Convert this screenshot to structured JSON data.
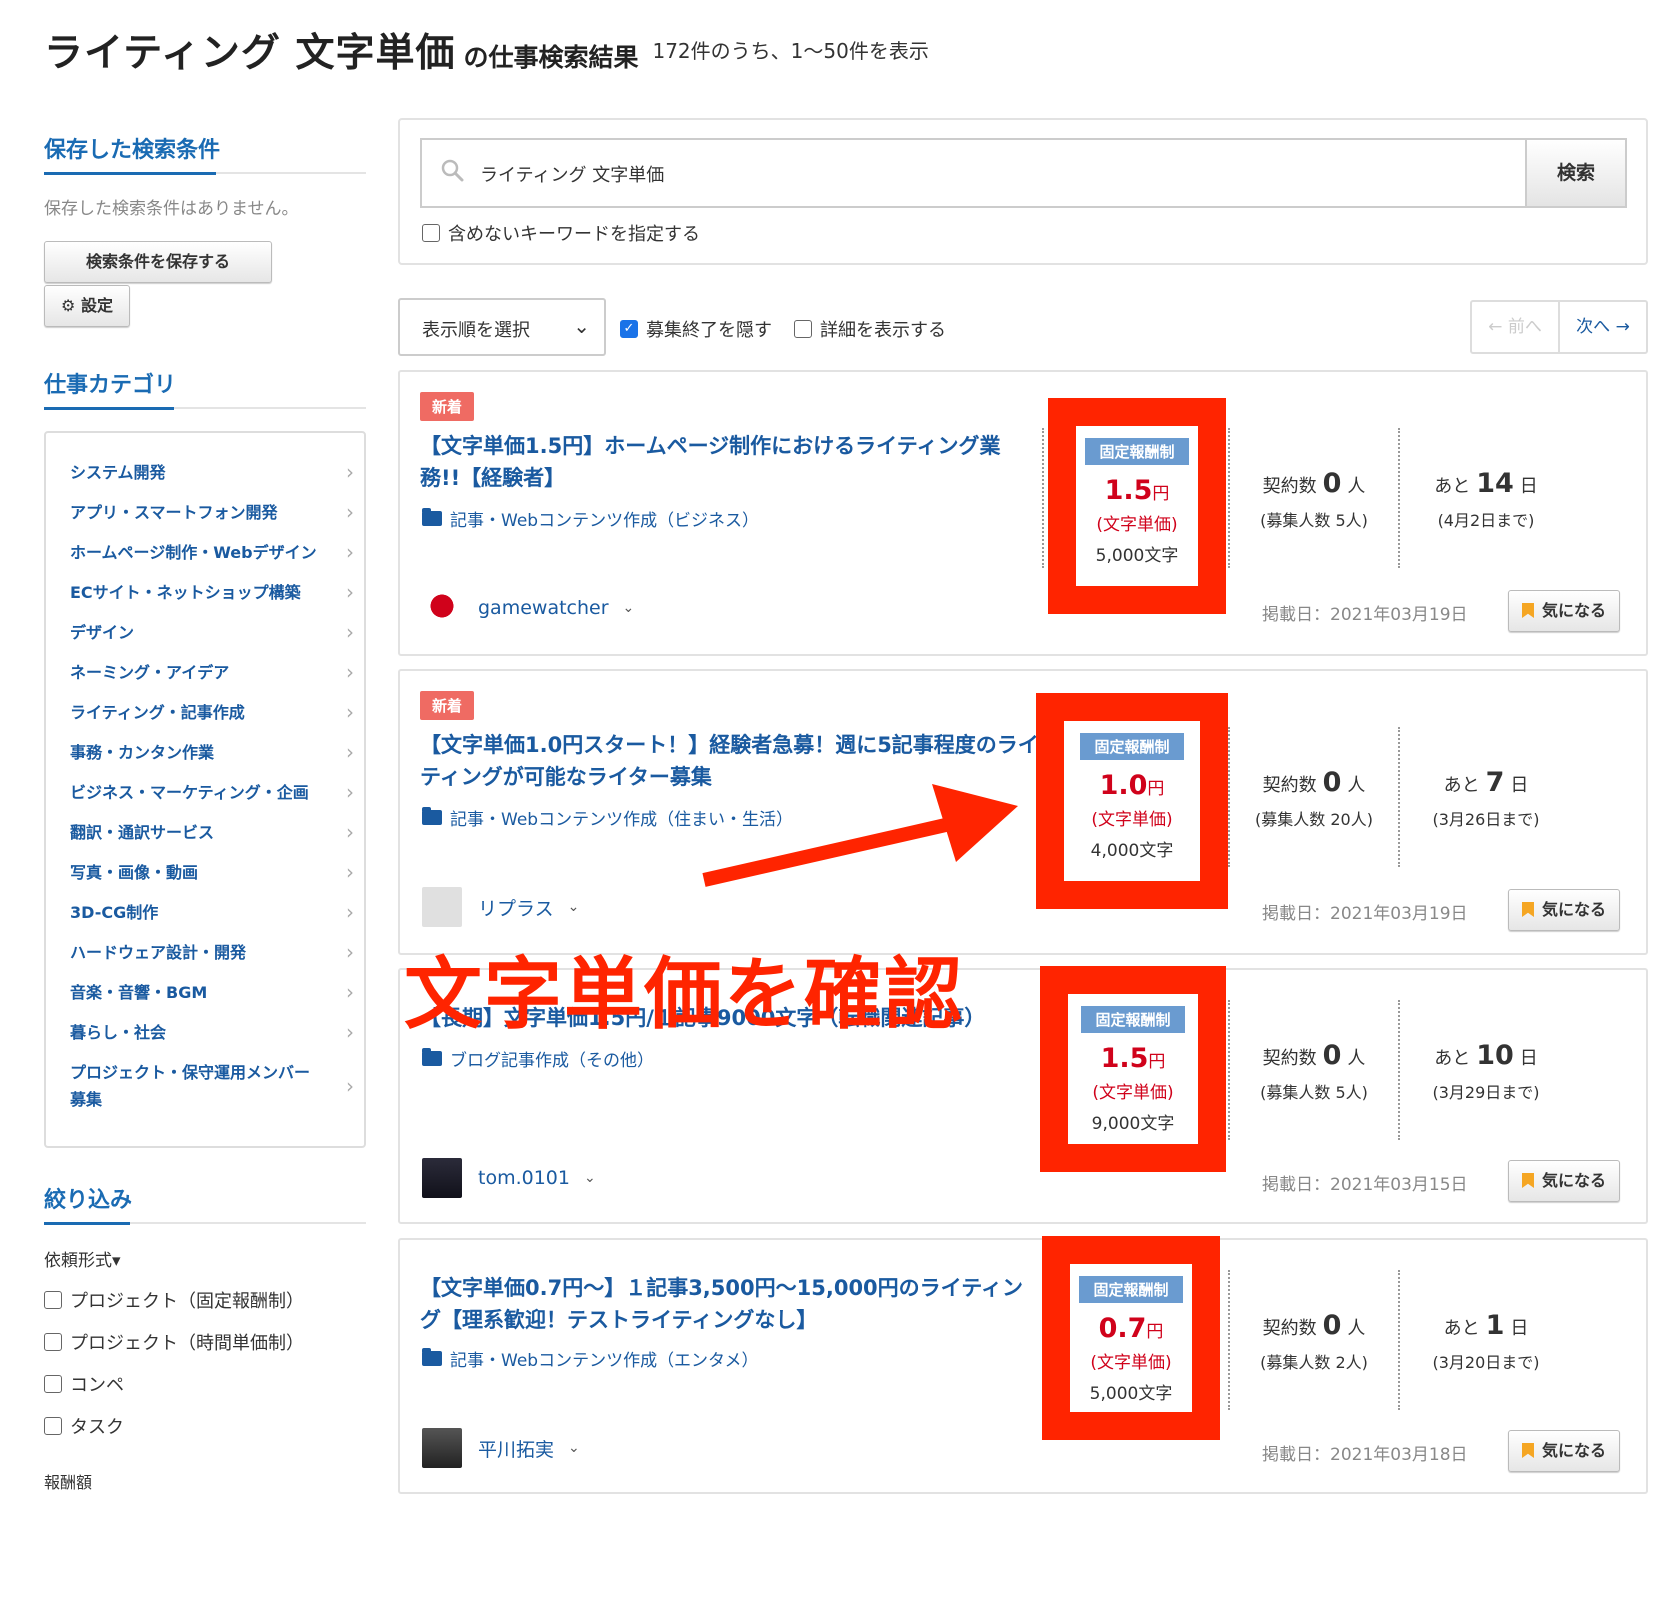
{
  "header": {
    "keyword": "ライティング 文字単価",
    "suffix": "の仕事検索結果",
    "count": "172件のうち、1〜50件を表示"
  },
  "sidebar": {
    "saved_heading": "保存した検索条件",
    "saved_empty": "保存した検索条件はありません。",
    "save_button": "検索条件を保存する",
    "settings_button": "⚙ 設定",
    "category_heading": "仕事カテゴリ",
    "categories": [
      "システム開発",
      "アプリ・スマートフォン開発",
      "ホームページ制作・Webデザイン",
      "ECサイト・ネットショップ構築",
      "デザイン",
      "ネーミング・アイデア",
      "ライティング・記事作成",
      "事務・カンタン作業",
      "ビジネス・マーケティング・企画",
      "翻訳・通訳サービス",
      "写真・画像・動画",
      "3D-CG制作",
      "ハードウェア設計・開発",
      "音楽・音響・BGM",
      "暮らし・社会",
      "プロジェクト・保守運用メンバー募集"
    ],
    "filter_heading": "絞り込み",
    "filter_type_label": "依頼形式▾",
    "filter_options": [
      "プロジェクト（固定報酬制）",
      "プロジェクト（時間単価制）",
      "コンペ",
      "タスク"
    ],
    "more_label": "報酬額"
  },
  "search": {
    "query": "ライティング 文字単価",
    "button": "検索",
    "exclude_label": "含めないキーワードを指定する"
  },
  "controls": {
    "sort_label": "表示順を選択",
    "hide_closed_label": "募集終了を隠す",
    "hide_closed_checked": true,
    "show_detail_label": "詳細を表示する",
    "show_detail_checked": false,
    "prev": "← 前へ",
    "next": "次へ →"
  },
  "jobs": [
    {
      "is_new": true,
      "new_label": "新着",
      "title": "【文字単価1.5円】ホームページ制作におけるライティング業務!!【経験者】",
      "category": "記事・Webコンテンツ作成（ビジネス）",
      "client": "gamewatcher",
      "price_type": "固定報酬制",
      "price": "1.5",
      "price_yen": "円",
      "price_unit": "(文字単価)",
      "chars": "5,000文字",
      "contracts_prefix": "契約数",
      "contracts": "0",
      "contracts_suffix": "人",
      "recruit": "(募集人数 5人)",
      "days_prefix": "あと",
      "days_left": "14",
      "days_suffix": "日",
      "deadline": "(4月2日まで)",
      "posted": "掲載日：2021年03月19日",
      "fav": "気になる"
    },
    {
      "is_new": true,
      "new_label": "新着",
      "title": "【文字単価1.0円スタート！】経験者急募！週に5記事程度のライティングが可能なライター募集",
      "category": "記事・Webコンテンツ作成（住まい・生活）",
      "client": "リプラス",
      "price_type": "固定報酬制",
      "price": "1.0",
      "price_yen": "円",
      "price_unit": "(文字単価)",
      "chars": "4,000文字",
      "contracts_prefix": "契約数",
      "contracts": "0",
      "contracts_suffix": "人",
      "recruit": "(募集人数 20人)",
      "days_prefix": "あと",
      "days_left": "7",
      "days_suffix": "日",
      "deadline": "(3月26日まで)",
      "posted": "掲載日：2021年03月19日",
      "fav": "気になる"
    },
    {
      "is_new": false,
      "title": "【長期】文字単価1.5円/１記事9000文字（転職関連記事）",
      "category": "ブログ記事作成（その他）",
      "client": "tom.0101",
      "price_type": "固定報酬制",
      "price": "1.5",
      "price_yen": "円",
      "price_unit": "(文字単価)",
      "chars": "9,000文字",
      "contracts_prefix": "契約数",
      "contracts": "0",
      "contracts_suffix": "人",
      "recruit": "(募集人数 5人)",
      "days_prefix": "あと",
      "days_left": "10",
      "days_suffix": "日",
      "deadline": "(3月29日まで)",
      "posted": "掲載日：2021年03月15日",
      "fav": "気になる"
    },
    {
      "is_new": false,
      "title": "【文字単価0.7円〜】１記事3,500円〜15,000円のライティング【理系歓迎！テストライティングなし】",
      "category": "記事・Webコンテンツ作成（エンタメ）",
      "client": "平川拓実",
      "price_type": "固定報酬制",
      "price": "0.7",
      "price_yen": "円",
      "price_unit": "(文字単価)",
      "chars": "5,000文字",
      "contracts_prefix": "契約数",
      "contracts": "0",
      "contracts_suffix": "人",
      "recruit": "(募集人数 2人)",
      "days_prefix": "あと",
      "days_left": "1",
      "days_suffix": "日",
      "deadline": "(3月20日まで)",
      "posted": "掲載日：2021年03月18日",
      "fav": "気になる"
    }
  ],
  "annotation": {
    "text": "文字単価を確認",
    "color": "#ff2400"
  },
  "colors": {
    "link": "#1a5aa0",
    "price": "#d0021b",
    "highlight": "#ff2400",
    "new_badge": "#ef6b63",
    "price_type_badge": "#6a9bd0"
  }
}
